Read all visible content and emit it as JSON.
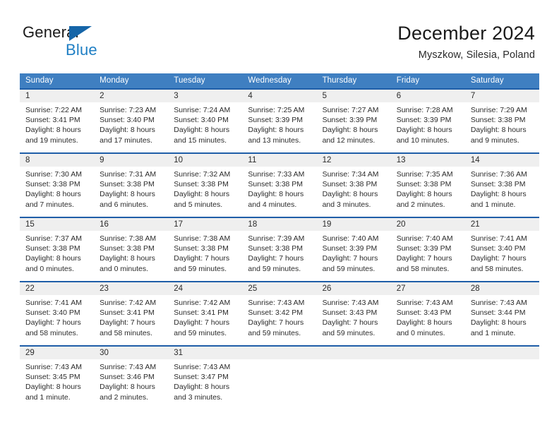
{
  "brand": {
    "name_part1": "General",
    "name_part2": "Blue",
    "accent_color": "#1f7fc4",
    "triangle_color": "#1565a8"
  },
  "header": {
    "title": "December 2024",
    "subtitle": "Myszkow, Silesia, Poland"
  },
  "calendar": {
    "header_bg": "#3f7fc1",
    "row_rule_color": "#1f5ea8",
    "daynum_bg": "#efefef",
    "weekdays": [
      "Sunday",
      "Monday",
      "Tuesday",
      "Wednesday",
      "Thursday",
      "Friday",
      "Saturday"
    ],
    "weeks": [
      [
        {
          "day": "1",
          "sunrise": "Sunrise: 7:22 AM",
          "sunset": "Sunset: 3:41 PM",
          "daylight1": "Daylight: 8 hours",
          "daylight2": "and 19 minutes."
        },
        {
          "day": "2",
          "sunrise": "Sunrise: 7:23 AM",
          "sunset": "Sunset: 3:40 PM",
          "daylight1": "Daylight: 8 hours",
          "daylight2": "and 17 minutes."
        },
        {
          "day": "3",
          "sunrise": "Sunrise: 7:24 AM",
          "sunset": "Sunset: 3:40 PM",
          "daylight1": "Daylight: 8 hours",
          "daylight2": "and 15 minutes."
        },
        {
          "day": "4",
          "sunrise": "Sunrise: 7:25 AM",
          "sunset": "Sunset: 3:39 PM",
          "daylight1": "Daylight: 8 hours",
          "daylight2": "and 13 minutes."
        },
        {
          "day": "5",
          "sunrise": "Sunrise: 7:27 AM",
          "sunset": "Sunset: 3:39 PM",
          "daylight1": "Daylight: 8 hours",
          "daylight2": "and 12 minutes."
        },
        {
          "day": "6",
          "sunrise": "Sunrise: 7:28 AM",
          "sunset": "Sunset: 3:39 PM",
          "daylight1": "Daylight: 8 hours",
          "daylight2": "and 10 minutes."
        },
        {
          "day": "7",
          "sunrise": "Sunrise: 7:29 AM",
          "sunset": "Sunset: 3:38 PM",
          "daylight1": "Daylight: 8 hours",
          "daylight2": "and 9 minutes."
        }
      ],
      [
        {
          "day": "8",
          "sunrise": "Sunrise: 7:30 AM",
          "sunset": "Sunset: 3:38 PM",
          "daylight1": "Daylight: 8 hours",
          "daylight2": "and 7 minutes."
        },
        {
          "day": "9",
          "sunrise": "Sunrise: 7:31 AM",
          "sunset": "Sunset: 3:38 PM",
          "daylight1": "Daylight: 8 hours",
          "daylight2": "and 6 minutes."
        },
        {
          "day": "10",
          "sunrise": "Sunrise: 7:32 AM",
          "sunset": "Sunset: 3:38 PM",
          "daylight1": "Daylight: 8 hours",
          "daylight2": "and 5 minutes."
        },
        {
          "day": "11",
          "sunrise": "Sunrise: 7:33 AM",
          "sunset": "Sunset: 3:38 PM",
          "daylight1": "Daylight: 8 hours",
          "daylight2": "and 4 minutes."
        },
        {
          "day": "12",
          "sunrise": "Sunrise: 7:34 AM",
          "sunset": "Sunset: 3:38 PM",
          "daylight1": "Daylight: 8 hours",
          "daylight2": "and 3 minutes."
        },
        {
          "day": "13",
          "sunrise": "Sunrise: 7:35 AM",
          "sunset": "Sunset: 3:38 PM",
          "daylight1": "Daylight: 8 hours",
          "daylight2": "and 2 minutes."
        },
        {
          "day": "14",
          "sunrise": "Sunrise: 7:36 AM",
          "sunset": "Sunset: 3:38 PM",
          "daylight1": "Daylight: 8 hours",
          "daylight2": "and 1 minute."
        }
      ],
      [
        {
          "day": "15",
          "sunrise": "Sunrise: 7:37 AM",
          "sunset": "Sunset: 3:38 PM",
          "daylight1": "Daylight: 8 hours",
          "daylight2": "and 0 minutes."
        },
        {
          "day": "16",
          "sunrise": "Sunrise: 7:38 AM",
          "sunset": "Sunset: 3:38 PM",
          "daylight1": "Daylight: 8 hours",
          "daylight2": "and 0 minutes."
        },
        {
          "day": "17",
          "sunrise": "Sunrise: 7:38 AM",
          "sunset": "Sunset: 3:38 PM",
          "daylight1": "Daylight: 7 hours",
          "daylight2": "and 59 minutes."
        },
        {
          "day": "18",
          "sunrise": "Sunrise: 7:39 AM",
          "sunset": "Sunset: 3:38 PM",
          "daylight1": "Daylight: 7 hours",
          "daylight2": "and 59 minutes."
        },
        {
          "day": "19",
          "sunrise": "Sunrise: 7:40 AM",
          "sunset": "Sunset: 3:39 PM",
          "daylight1": "Daylight: 7 hours",
          "daylight2": "and 59 minutes."
        },
        {
          "day": "20",
          "sunrise": "Sunrise: 7:40 AM",
          "sunset": "Sunset: 3:39 PM",
          "daylight1": "Daylight: 7 hours",
          "daylight2": "and 58 minutes."
        },
        {
          "day": "21",
          "sunrise": "Sunrise: 7:41 AM",
          "sunset": "Sunset: 3:40 PM",
          "daylight1": "Daylight: 7 hours",
          "daylight2": "and 58 minutes."
        }
      ],
      [
        {
          "day": "22",
          "sunrise": "Sunrise: 7:41 AM",
          "sunset": "Sunset: 3:40 PM",
          "daylight1": "Daylight: 7 hours",
          "daylight2": "and 58 minutes."
        },
        {
          "day": "23",
          "sunrise": "Sunrise: 7:42 AM",
          "sunset": "Sunset: 3:41 PM",
          "daylight1": "Daylight: 7 hours",
          "daylight2": "and 58 minutes."
        },
        {
          "day": "24",
          "sunrise": "Sunrise: 7:42 AM",
          "sunset": "Sunset: 3:41 PM",
          "daylight1": "Daylight: 7 hours",
          "daylight2": "and 59 minutes."
        },
        {
          "day": "25",
          "sunrise": "Sunrise: 7:43 AM",
          "sunset": "Sunset: 3:42 PM",
          "daylight1": "Daylight: 7 hours",
          "daylight2": "and 59 minutes."
        },
        {
          "day": "26",
          "sunrise": "Sunrise: 7:43 AM",
          "sunset": "Sunset: 3:43 PM",
          "daylight1": "Daylight: 7 hours",
          "daylight2": "and 59 minutes."
        },
        {
          "day": "27",
          "sunrise": "Sunrise: 7:43 AM",
          "sunset": "Sunset: 3:43 PM",
          "daylight1": "Daylight: 8 hours",
          "daylight2": "and 0 minutes."
        },
        {
          "day": "28",
          "sunrise": "Sunrise: 7:43 AM",
          "sunset": "Sunset: 3:44 PM",
          "daylight1": "Daylight: 8 hours",
          "daylight2": "and 1 minute."
        }
      ],
      [
        {
          "day": "29",
          "sunrise": "Sunrise: 7:43 AM",
          "sunset": "Sunset: 3:45 PM",
          "daylight1": "Daylight: 8 hours",
          "daylight2": "and 1 minute."
        },
        {
          "day": "30",
          "sunrise": "Sunrise: 7:43 AM",
          "sunset": "Sunset: 3:46 PM",
          "daylight1": "Daylight: 8 hours",
          "daylight2": "and 2 minutes."
        },
        {
          "day": "31",
          "sunrise": "Sunrise: 7:43 AM",
          "sunset": "Sunset: 3:47 PM",
          "daylight1": "Daylight: 8 hours",
          "daylight2": "and 3 minutes."
        },
        {
          "day": "",
          "sunrise": "",
          "sunset": "",
          "daylight1": "",
          "daylight2": ""
        },
        {
          "day": "",
          "sunrise": "",
          "sunset": "",
          "daylight1": "",
          "daylight2": ""
        },
        {
          "day": "",
          "sunrise": "",
          "sunset": "",
          "daylight1": "",
          "daylight2": ""
        },
        {
          "day": "",
          "sunrise": "",
          "sunset": "",
          "daylight1": "",
          "daylight2": ""
        }
      ]
    ]
  }
}
